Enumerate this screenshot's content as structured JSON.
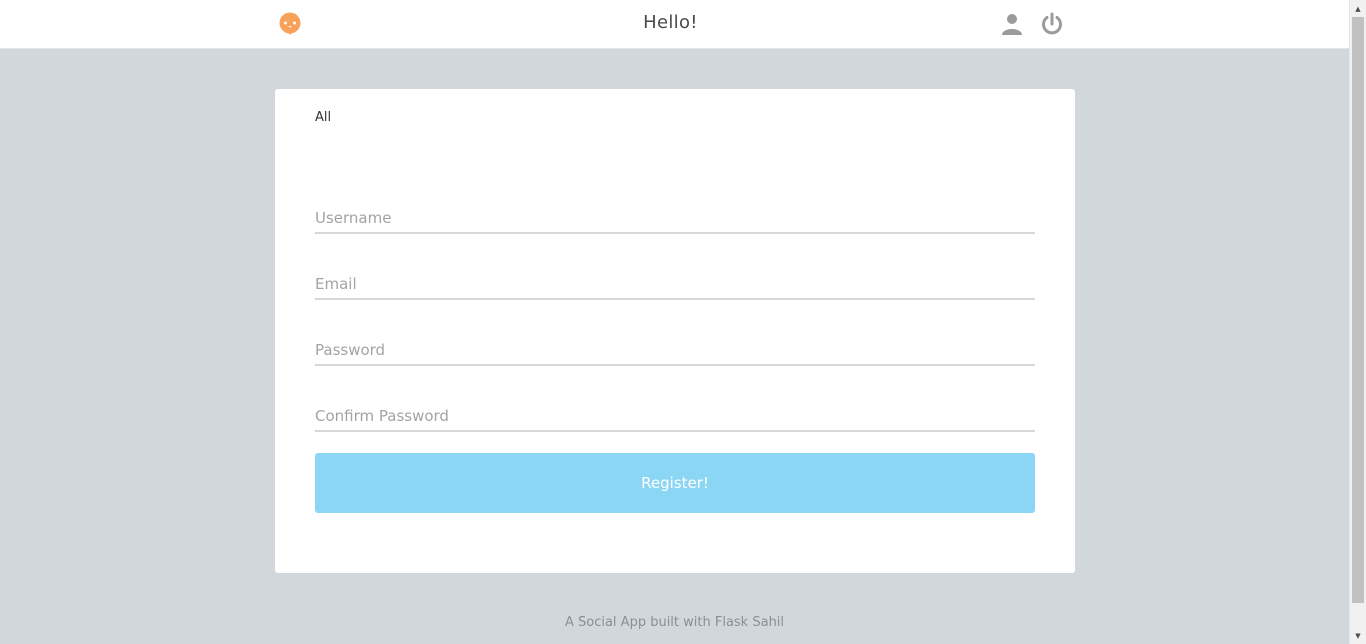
{
  "header": {
    "title": "Hello!",
    "logo_icon": "chat-bubble-face-icon",
    "logo_color": "#f7a15a",
    "user_icon": "user-icon",
    "logout_icon": "power-icon"
  },
  "tabs": {
    "all_label": "All"
  },
  "form": {
    "username_placeholder": "Username",
    "email_placeholder": "Email",
    "password_placeholder": "Password",
    "confirm_password_placeholder": "Confirm Password",
    "submit_label": "Register!",
    "submit_color": "#8bd5f5"
  },
  "footer": {
    "text": "A Social App built with Flask Sahil"
  },
  "colors": {
    "background": "#d2d7db",
    "card": "#ffffff",
    "icon_gray": "#9b9b9b"
  }
}
